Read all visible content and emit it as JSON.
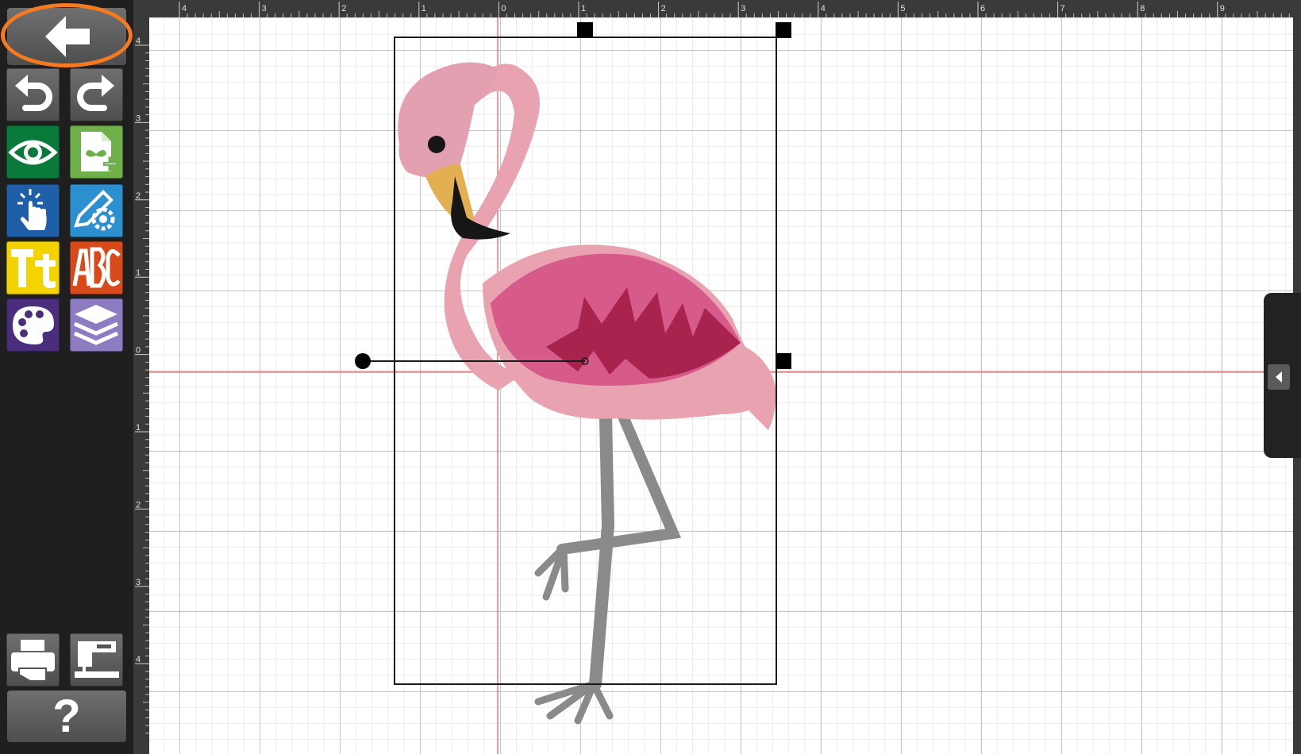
{
  "toolbar": {
    "buttons": [
      {
        "id": "back",
        "icon": "back-arrow-icon"
      },
      {
        "id": "undo",
        "icon": "undo-icon"
      },
      {
        "id": "redo",
        "icon": "redo-icon"
      },
      {
        "id": "preview",
        "icon": "eye-icon",
        "color": "#0a7a3a"
      },
      {
        "id": "add-design",
        "icon": "add-design-file-icon",
        "color": "#6fb04a"
      },
      {
        "id": "select",
        "icon": "tap-hand-icon",
        "color": "#1f5fa8"
      },
      {
        "id": "edit-tools",
        "icon": "pencil-gear-icon",
        "color": "#2b8fd0"
      },
      {
        "id": "text",
        "icon": "text-tt-icon",
        "color": "#f4d400"
      },
      {
        "id": "monogram",
        "icon": "monogram-abc-icon",
        "color": "#d94a1a"
      },
      {
        "id": "colors",
        "icon": "palette-icon",
        "color": "#4b2d7e"
      },
      {
        "id": "layers",
        "icon": "layers-icon",
        "color": "#8e7cc3"
      },
      {
        "id": "print",
        "icon": "printer-icon"
      },
      {
        "id": "send-to-machine",
        "icon": "sewing-machine-icon"
      }
    ],
    "help_label": "?"
  },
  "rulers": {
    "top_labels": [
      "4",
      "3",
      "2",
      "1",
      "0",
      "1",
      "2",
      "3",
      "4",
      "5",
      "6",
      "7",
      "8",
      "9"
    ],
    "left_labels": [
      "4",
      "3",
      "2",
      "1",
      "0",
      "1",
      "2",
      "3",
      "4"
    ]
  },
  "canvas": {
    "design": "flamingo embroidery",
    "colors": {
      "body_light": "#e8a2b0",
      "head_pink": "#e3a0b1",
      "wing_pink": "#d65a8a",
      "wing_dark": "#a8234e",
      "beak_yellow": "#e2b050",
      "beak_black": "#161616",
      "legs_gray": "#8a8a8a",
      "crosshair": "#e23a3a",
      "highlight": "#f57a20"
    }
  },
  "side_panel": {
    "toggle_icon": "chevron-left-icon"
  }
}
